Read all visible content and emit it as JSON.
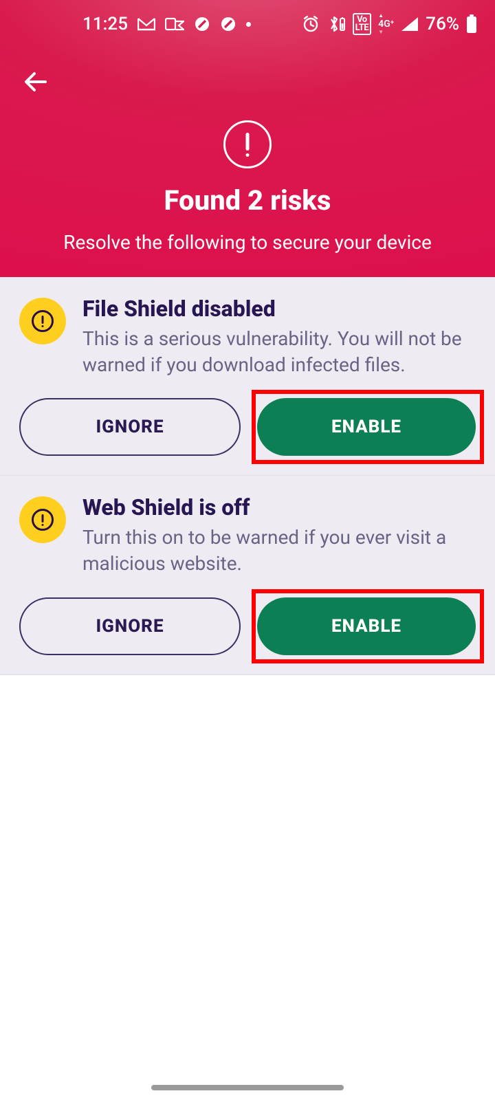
{
  "status_bar": {
    "time": "11:25",
    "battery_pct": "76%",
    "network_label_top": "4G⁺",
    "lte_top": "Vo",
    "lte_bottom": "LTE"
  },
  "hero": {
    "title": "Found 2 risks",
    "subtitle": "Resolve the following to secure your device"
  },
  "risks": [
    {
      "title": "File Shield disabled",
      "description": "This is a serious vulnerability. You will not be warned if you download infected files.",
      "ignore_label": "IGNORE",
      "enable_label": "ENABLE"
    },
    {
      "title": "Web Shield is off",
      "description": "Turn this on to be warned if you ever visit a malicious website.",
      "ignore_label": "IGNORE",
      "enable_label": "ENABLE"
    }
  ]
}
